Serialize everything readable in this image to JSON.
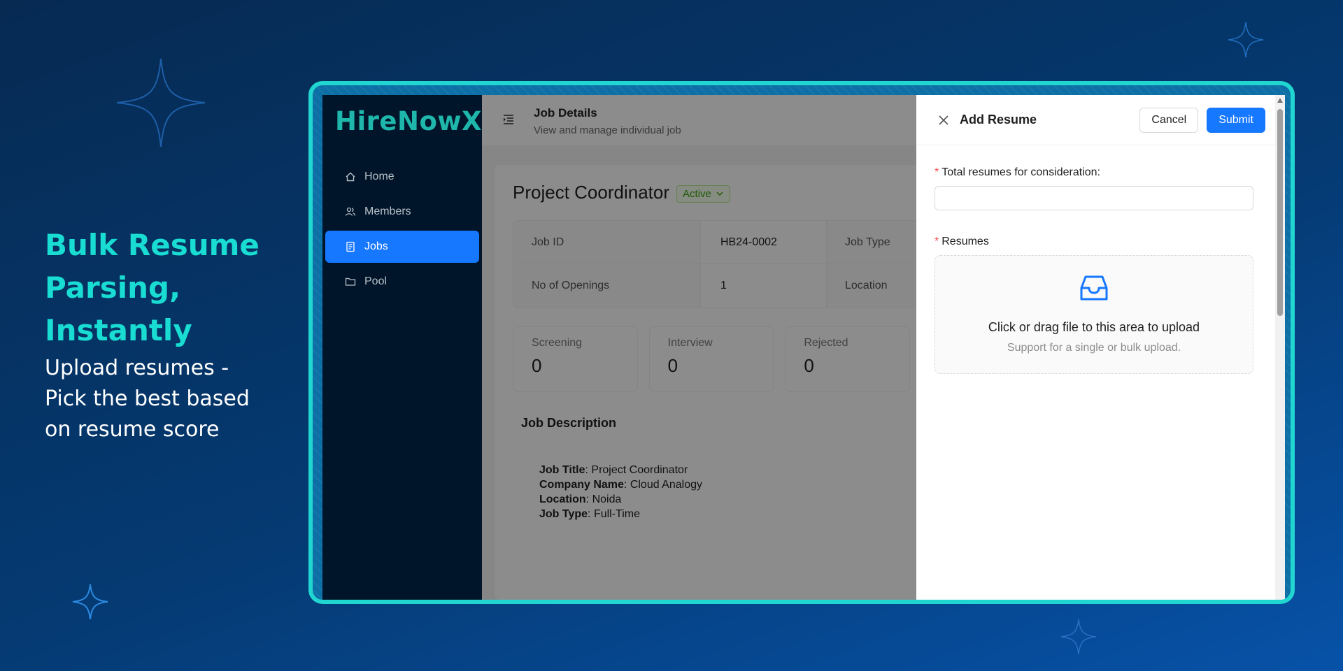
{
  "promo": {
    "title_lines": [
      "Bulk Resume",
      "Parsing,",
      "Instantly"
    ],
    "subtitle_lines": [
      "Upload resumes -",
      "Pick the best based",
      "on resume score"
    ]
  },
  "app": {
    "logo": "HireNowX",
    "nav": [
      {
        "label": "Home",
        "icon": "home-icon",
        "active": false
      },
      {
        "label": "Members",
        "icon": "members-icon",
        "active": false
      },
      {
        "label": "Jobs",
        "icon": "jobs-icon",
        "active": true
      },
      {
        "label": "Pool",
        "icon": "folder-icon",
        "active": false
      }
    ],
    "header": {
      "title": "Job Details",
      "subtitle": "View and manage individual job"
    },
    "job": {
      "title": "Project Coordinator",
      "status": "Active",
      "details": [
        {
          "label": "Job ID",
          "value": "HB24-0002",
          "label2": "Job Type"
        },
        {
          "label": "No of Openings",
          "value": "1",
          "label2": "Location"
        }
      ],
      "stats": [
        {
          "label": "Screening",
          "value": "0"
        },
        {
          "label": "Interview",
          "value": "0"
        },
        {
          "label": "Rejected",
          "value": "0"
        }
      ],
      "description_heading": "Job Description",
      "description": [
        {
          "key": "Job Title",
          "value": ": Project Coordinator"
        },
        {
          "key": "Company Name",
          "value": ": Cloud Analogy"
        },
        {
          "key": "Location",
          "value": ": Noida"
        },
        {
          "key": "Job Type",
          "value": ": Full-Time"
        }
      ]
    },
    "drawer": {
      "title": "Add Resume",
      "cancel_label": "Cancel",
      "submit_label": "Submit",
      "total_label": "Total resumes for consideration:",
      "total_value": "",
      "resumes_label": "Resumes",
      "upload_text": "Click or drag file to this area to upload",
      "upload_hint": "Support for a single or bulk upload."
    }
  },
  "colors": {
    "accent": "#1677ff",
    "brand": "#1fb7ab",
    "promo_title": "#19dcd2",
    "frame": "#21d5d0",
    "sidebar": "#001529"
  }
}
